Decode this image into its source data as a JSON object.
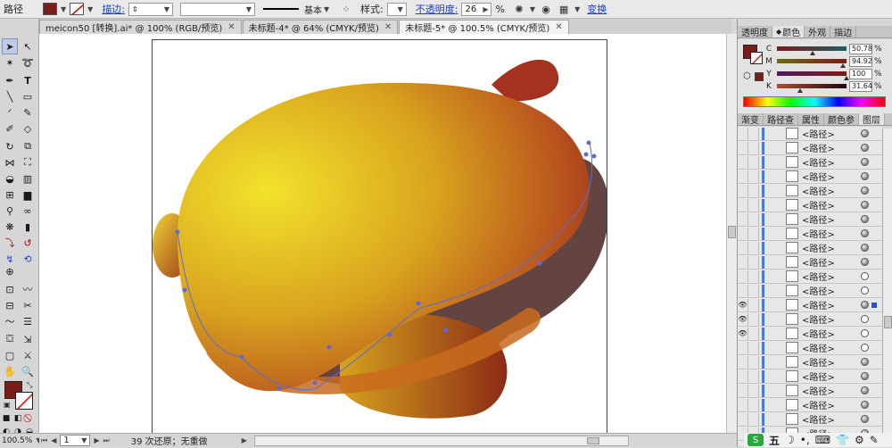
{
  "control_bar": {
    "object_label": "路径",
    "fill_color": "#7a1c17",
    "stroke_link": "描边:",
    "stroke_weight_arrows": "◆",
    "line_style_label": "基本",
    "style_label": "样式:",
    "opacity_link": "不透明度:",
    "opacity_value": "26",
    "opacity_unit": "%",
    "transform_link": "变换"
  },
  "tabs": [
    {
      "label": "meicon50 [转换].ai* @ 100% (RGB/预览)"
    },
    {
      "label": "未标题-4* @ 64% (CMYK/预览)"
    },
    {
      "label": "未标题-5* @ 100.5% (CMYK/预览)"
    }
  ],
  "status": {
    "zoom": "100.5%",
    "page": "1",
    "undo_info": "39 次还原；无重做"
  },
  "color_panel": {
    "tabs": [
      "透明度",
      "颜色",
      "外观",
      "描边"
    ],
    "swatch": "#7a1c17",
    "channels": [
      {
        "name": "C",
        "value": "50.78"
      },
      {
        "name": "M",
        "value": "94.92"
      },
      {
        "name": "Y",
        "value": "100"
      },
      {
        "name": "K",
        "value": "31.64"
      }
    ],
    "unit": "%"
  },
  "layers_panel": {
    "tabs": [
      "渐变",
      "路径查",
      "属性",
      "颜色参",
      "图层"
    ],
    "rows": [
      {
        "name": "<路径>",
        "visible": false,
        "target": "filled"
      },
      {
        "name": "<路径>",
        "visible": false,
        "target": "filled"
      },
      {
        "name": "<路径>",
        "visible": false,
        "target": "filled"
      },
      {
        "name": "<路径>",
        "visible": false,
        "target": "filled"
      },
      {
        "name": "<路径>",
        "visible": false,
        "target": "filled"
      },
      {
        "name": "<路径>",
        "visible": false,
        "target": "filled"
      },
      {
        "name": "<路径>",
        "visible": false,
        "target": "filled"
      },
      {
        "name": "<路径>",
        "visible": false,
        "target": "filled"
      },
      {
        "name": "<路径>",
        "visible": false,
        "target": "filled"
      },
      {
        "name": "<路径>",
        "visible": false,
        "target": "filled"
      },
      {
        "name": "<路径>",
        "visible": false,
        "target": "hollow"
      },
      {
        "name": "<路径>",
        "visible": false,
        "target": "hollow"
      },
      {
        "name": "<路径>",
        "visible": true,
        "target": "filled",
        "selected": true
      },
      {
        "name": "<路径>",
        "visible": true,
        "target": "hollow"
      },
      {
        "name": "<路径>",
        "visible": true,
        "target": "hollow"
      },
      {
        "name": "<路径>",
        "visible": false,
        "target": "hollow"
      },
      {
        "name": "<路径>",
        "visible": false,
        "target": "filled"
      },
      {
        "name": "<路径>",
        "visible": false,
        "target": "filled"
      },
      {
        "name": "<路径>",
        "visible": false,
        "target": "filled"
      },
      {
        "name": "<路径>",
        "visible": false,
        "target": "filled"
      },
      {
        "name": "<路径>",
        "visible": false,
        "target": "filled"
      },
      {
        "name": "<路径>",
        "visible": false,
        "target": "filled"
      }
    ]
  },
  "ime_bar": {
    "items": [
      "五",
      "☽",
      "•,",
      "⌨",
      "👕",
      "⚙",
      "✎"
    ]
  },
  "tools_panel": {
    "fill_color": "#7a1c17"
  }
}
